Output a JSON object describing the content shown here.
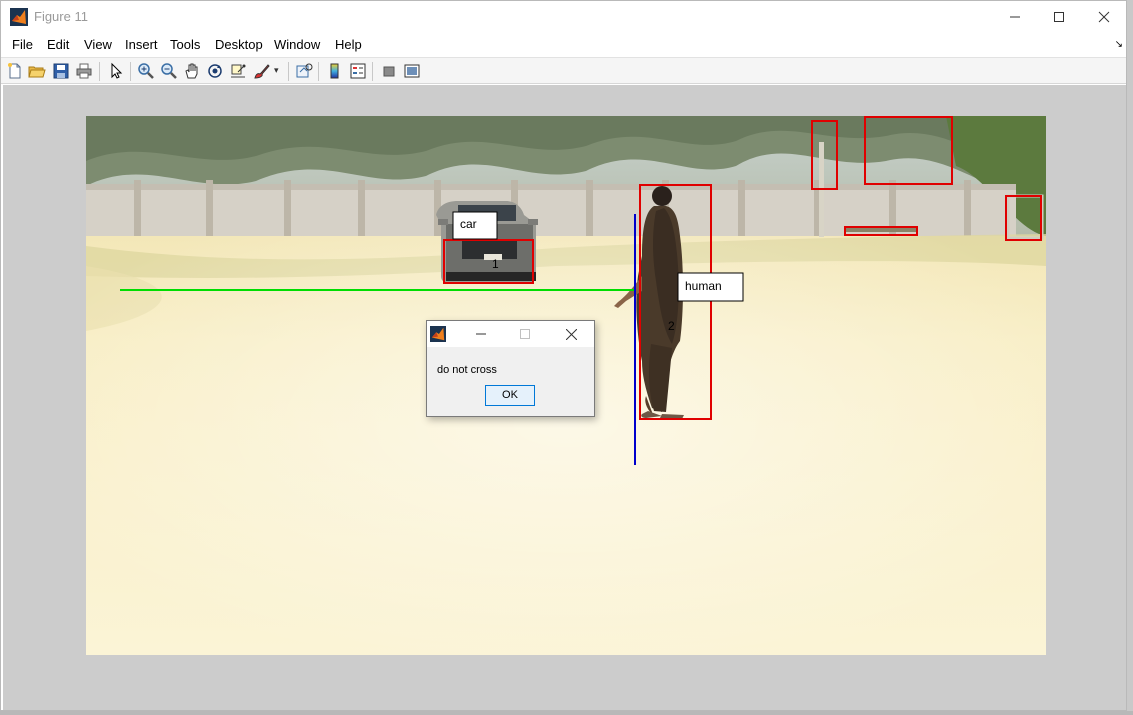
{
  "window": {
    "title": "Figure 11"
  },
  "menu": [
    "File",
    "Edit",
    "View",
    "Insert",
    "Tools",
    "Desktop",
    "Window",
    "Help"
  ],
  "toolbar": {
    "buttons": [
      "new-figure-icon",
      "open-file-icon",
      "save-icon",
      "print-icon",
      "pointer-icon",
      "zoom-in-icon",
      "zoom-out-icon",
      "pan-icon",
      "rotate-3d-icon",
      "data-cursor-icon",
      "brush-icon",
      "link-plot-icon",
      "insert-colorbar-icon",
      "insert-legend-icon",
      "hide-plot-tools-icon",
      "show-plot-tools-icon"
    ]
  },
  "annotations": {
    "car_label": "car",
    "car_id": "1",
    "human_label": "human",
    "human_id": "2"
  },
  "colors": {
    "box": "#e00000",
    "line_green": "#00dd00",
    "line_blue": "#0000cc",
    "accent": "#0078d7"
  },
  "dialog": {
    "message": "do not cross",
    "ok_label": "OK"
  }
}
